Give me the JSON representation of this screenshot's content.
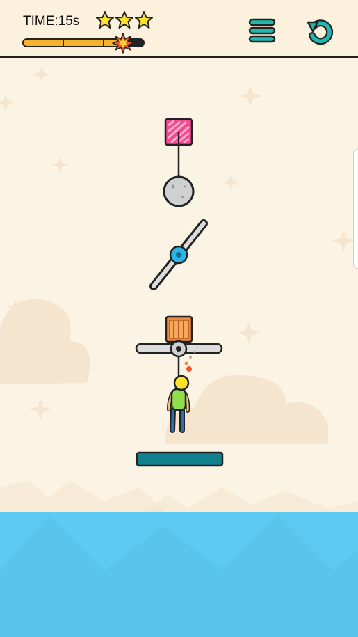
{
  "hud": {
    "time_label": "TIME:15s",
    "stars_earned": 3,
    "stars_total": 3,
    "time_progress": 0.82
  },
  "icons": {
    "menu": "hamburger-menu-icon",
    "restart": "restart-icon",
    "star": "star-icon",
    "explosion": "explosion-icon"
  },
  "colors": {
    "accent": "#1fb9b1",
    "star": "#ffe02a",
    "progress": "#f4b32a",
    "water": "#5ccaf2",
    "platform": "#13808f",
    "spinner_hub": "#27b5ea",
    "crate": "#f08a3c",
    "anchor_block": "#f7498f"
  }
}
